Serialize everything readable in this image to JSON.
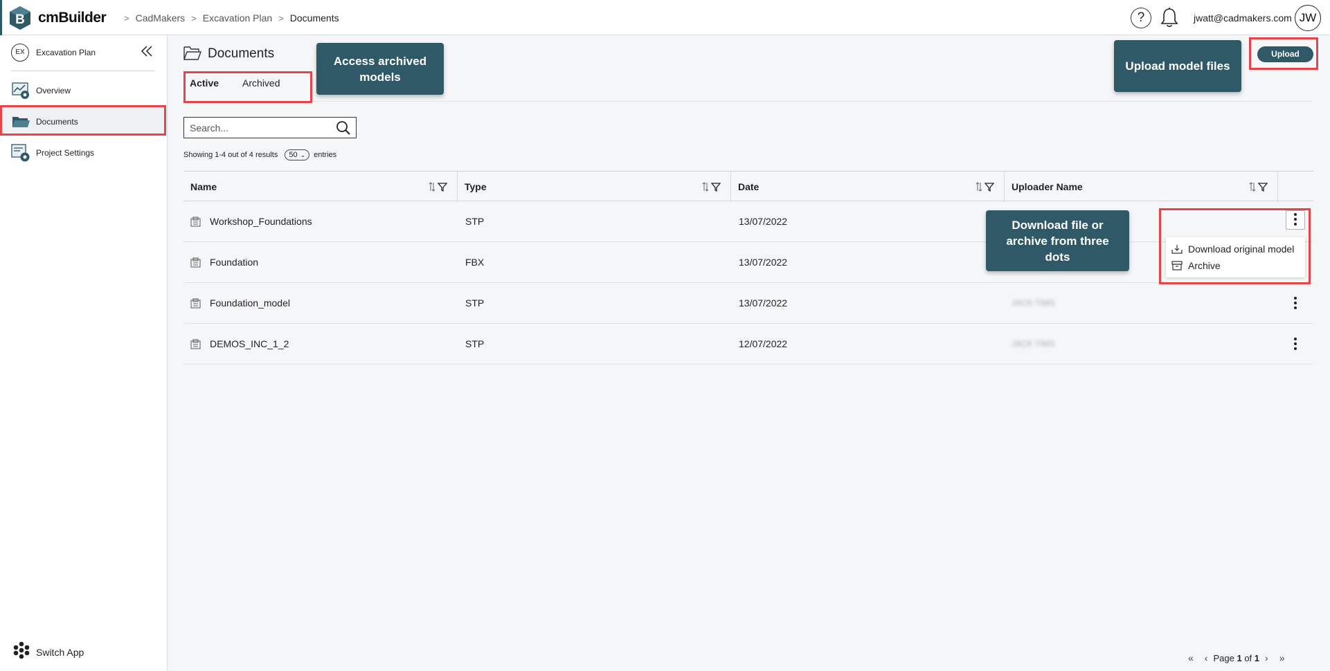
{
  "app": {
    "name": "cmBuilder"
  },
  "breadcrumb": [
    "CadMakers",
    "Excavation Plan",
    "Documents"
  ],
  "header": {
    "user_email": "jwatt@cadmakers.com",
    "avatar_initials": "JW",
    "help_label": "?"
  },
  "sidebar": {
    "project_badge": "EX",
    "project_name": "Excavation Plan",
    "items": [
      {
        "label": "Overview",
        "icon": "overview-icon"
      },
      {
        "label": "Documents",
        "icon": "folder-icon",
        "active": true
      },
      {
        "label": "Project Settings",
        "icon": "settings-icon"
      }
    ],
    "switch_app": "Switch App"
  },
  "main": {
    "title": "Documents",
    "tabs": [
      {
        "label": "Active",
        "active": true
      },
      {
        "label": "Archived"
      }
    ],
    "upload_label": "Upload",
    "search_placeholder": "Search...",
    "showing_prefix": "Showing 1-4 out of 4 results",
    "per_page": "50",
    "entries_label": "entries",
    "columns": [
      "Name",
      "Type",
      "Date",
      "Uploader Name"
    ],
    "rows": [
      {
        "name": "Workshop_Foundations",
        "type": "STP",
        "date": "13/07/2022",
        "uploader": ""
      },
      {
        "name": "Foundation",
        "type": "FBX",
        "date": "13/07/2022",
        "uploader": ""
      },
      {
        "name": "Foundation_model",
        "type": "STP",
        "date": "13/07/2022",
        "uploader": "JACK TIMS"
      },
      {
        "name": "DEMOS_INC_1_2",
        "type": "STP",
        "date": "12/07/2022",
        "uploader": "JACK TIMS"
      }
    ],
    "row_menu": {
      "download": "Download original model",
      "archive": "Archive"
    }
  },
  "callouts": {
    "archived": "Access archived models",
    "upload": "Upload model files",
    "download": "Download file or archive from three dots"
  },
  "pager": {
    "prefix": "Page",
    "current": "1",
    "of": "of",
    "total": "1"
  },
  "colors": {
    "accent": "#2f5967",
    "highlight": "#e8424a"
  }
}
